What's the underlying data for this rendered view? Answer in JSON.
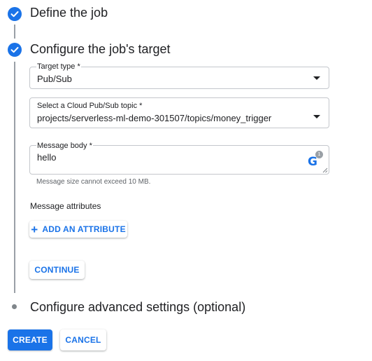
{
  "steps": [
    {
      "title": "Define the job",
      "state": "complete"
    },
    {
      "title": "Configure the job's target",
      "state": "complete"
    },
    {
      "title": "Configure advanced settings (optional)",
      "state": "pending"
    }
  ],
  "form": {
    "target_type": {
      "label": "Target type *",
      "value": "Pub/Sub"
    },
    "topic": {
      "label": "Select a Cloud Pub/Sub topic *",
      "value": "projects/serverless-ml-demo-301507/topics/money_trigger"
    },
    "message_body": {
      "label": "Message body *",
      "value": "hello",
      "hint": "Message size cannot exceed 10 MB."
    },
    "grammarly": {
      "icon": "grammarly-icon",
      "letter": "G",
      "count": "1"
    },
    "attributes": {
      "label": "Message attributes",
      "add_button": "ADD AN ATTRIBUTE",
      "add_icon": "+"
    },
    "continue_button": "CONTINUE"
  },
  "actions": {
    "create": "CREATE",
    "cancel": "CANCEL"
  },
  "colors": {
    "primary": "#1a73e8",
    "border": "#c4c7cc",
    "rail": "#9aa0a6"
  }
}
